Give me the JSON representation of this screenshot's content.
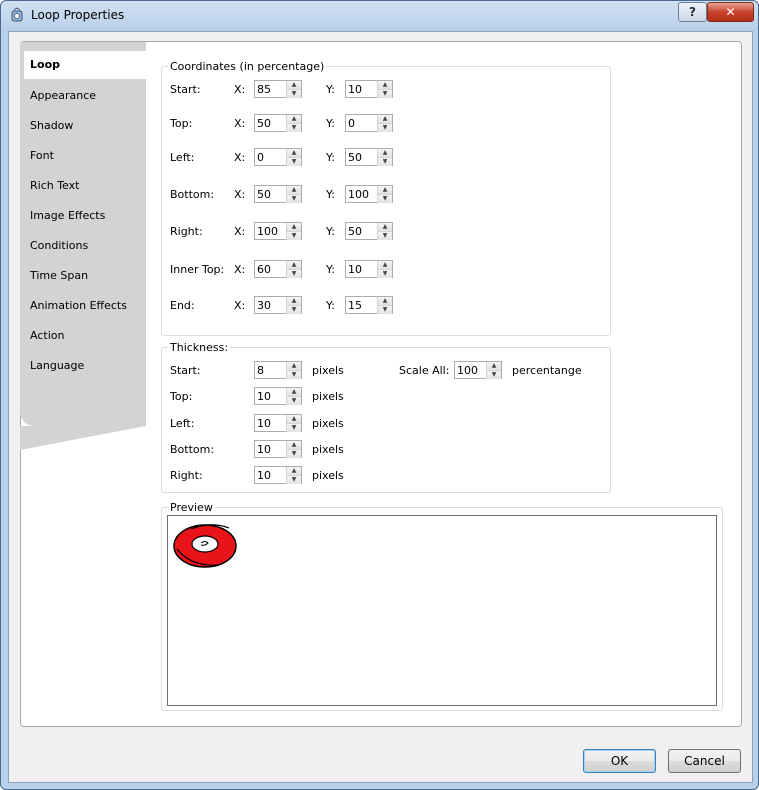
{
  "window": {
    "title": "Loop Properties",
    "help_label": "?",
    "close_label": "✕"
  },
  "tabs": [
    "Loop",
    "Appearance",
    "Shadow",
    "Font",
    "Rich Text",
    "Image Effects",
    "Conditions",
    "Time Span",
    "Animation Effects",
    "Action",
    "Language"
  ],
  "coordinates": {
    "legend": "Coordinates (in percentage)",
    "x_label": "X:",
    "y_label": "Y:",
    "rows": [
      {
        "label": "Start:",
        "x": "85",
        "y": "10"
      },
      {
        "label": "Top:",
        "x": "50",
        "y": "0"
      },
      {
        "label": "Left:",
        "x": "0",
        "y": "50"
      },
      {
        "label": "Bottom:",
        "x": "50",
        "y": "100"
      },
      {
        "label": "Right:",
        "x": "100",
        "y": "50"
      },
      {
        "label": "Inner Top:",
        "x": "60",
        "y": "10"
      },
      {
        "label": "End:",
        "x": "30",
        "y": "15"
      }
    ]
  },
  "thickness": {
    "legend": "Thickness:",
    "unit": "pixels",
    "rows": [
      {
        "label": "Start:",
        "value": "8"
      },
      {
        "label": "Top:",
        "value": "10"
      },
      {
        "label": "Left:",
        "value": "10"
      },
      {
        "label": "Bottom:",
        "value": "10"
      },
      {
        "label": "Right:",
        "value": "10"
      }
    ],
    "scale_label": "Scale All:",
    "scale_value": "100",
    "scale_unit": "percentange"
  },
  "preview": {
    "legend": "Preview"
  },
  "buttons": {
    "ok": "OK",
    "cancel": "Cancel"
  },
  "colors": {
    "loop_fill": "#e8141a",
    "accent": "#3c7fb1"
  }
}
